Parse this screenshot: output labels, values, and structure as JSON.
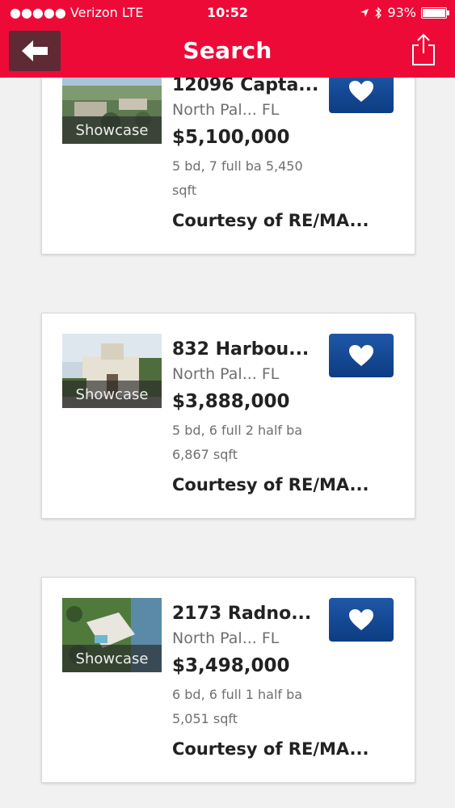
{
  "status_bar": {
    "carrier": "●●●●● Verizon  LTE",
    "time": "10:52",
    "battery": "93%"
  },
  "header": {
    "title": "Search"
  },
  "listings": [
    {
      "address": "12096 Capta...",
      "city": "North Pal...  FL",
      "price": "$5,100,000",
      "details": "5 bd, 7 full ba 5,450 sqft",
      "courtesy": "Courtesy of RE/MA...",
      "badge": "Showcase"
    },
    {
      "address": "832 Harbou...",
      "city": "North Pal...  FL",
      "price": "$3,888,000",
      "details": "5 bd, 6 full 2 half ba 6,867 sqft",
      "courtesy": "Courtesy of RE/MA...",
      "badge": "Showcase"
    },
    {
      "address": "2173 Radno...",
      "city": "North Pal...  FL",
      "price": "$3,498,000",
      "details": "6 bd, 6 full 1 half ba 5,051 sqft",
      "courtesy": "Courtesy of RE/MA...",
      "badge": "Showcase"
    }
  ],
  "colors": {
    "header_bg": "#ee0a37",
    "favorite_button": "#1f57a8"
  },
  "icons": [
    "back-arrow-icon",
    "share-icon",
    "heart-icon",
    "location-arrow-icon",
    "bluetooth-icon",
    "battery-icon"
  ]
}
